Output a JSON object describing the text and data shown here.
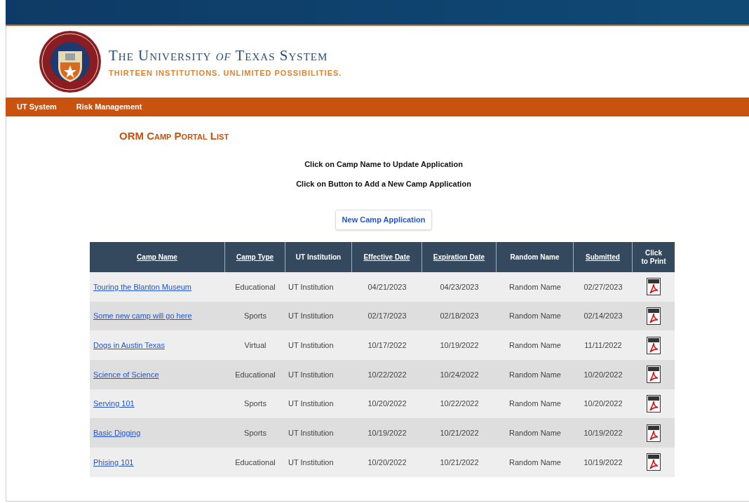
{
  "header": {
    "title": "The University *of* Texas System",
    "tagline": "THIRTEEN INSTITUTIONS. UNLIMITED POSSIBILITIES."
  },
  "nav": {
    "items": [
      "UT System",
      "Risk Management"
    ]
  },
  "page_title": "ORM Camp Portal List",
  "instructions": [
    "Click on Camp Name to Update Application",
    "Click on Button to Add a New Camp Application"
  ],
  "new_button": "New Camp Application",
  "table": {
    "columns": [
      {
        "label": "Camp Name",
        "kind": "sortable"
      },
      {
        "label": "Camp Type",
        "kind": "sortable"
      },
      {
        "label": "UT Institution",
        "kind": "plain"
      },
      {
        "label": "Effective Date",
        "kind": "sortable"
      },
      {
        "label": "Expiration Date",
        "kind": "sortable"
      },
      {
        "label": "Random Name",
        "kind": "plain"
      },
      {
        "label": "Submitted",
        "kind": "sortable"
      },
      {
        "label": "Click to Print",
        "kind": "plain"
      }
    ],
    "rows": [
      {
        "camp_name": "Touring the Blanton Museum",
        "camp_type": "Educational",
        "institution": "UT Institution",
        "effective": "04/21/2023",
        "expiration": "04/23/2023",
        "random_name": "Random Name",
        "submitted": "02/27/2023"
      },
      {
        "camp_name": "Some new camp will go here",
        "camp_type": "Sports",
        "institution": "UT Institution",
        "effective": "02/17/2023",
        "expiration": "02/18/2023",
        "random_name": "Random Name",
        "submitted": "02/14/2023"
      },
      {
        "camp_name": "Dogs in Austin Texas",
        "camp_type": "Virtual",
        "institution": "UT Institution",
        "effective": "10/17/2022",
        "expiration": "10/19/2022",
        "random_name": "Random Name",
        "submitted": "11/11/2022"
      },
      {
        "camp_name": "Science of Science",
        "camp_type": "Educational",
        "institution": "UT Institution",
        "effective": "10/22/2022",
        "expiration": "10/24/2022",
        "random_name": "Random Name",
        "submitted": "10/20/2022"
      },
      {
        "camp_name": "Serving 101",
        "camp_type": "Sports",
        "institution": "UT Institution",
        "effective": "10/20/2022",
        "expiration": "10/22/2022",
        "random_name": "Random Name",
        "submitted": "10/20/2022"
      },
      {
        "camp_name": "Basic Digging",
        "camp_type": "Sports",
        "institution": "UT Institution",
        "effective": "10/19/2022",
        "expiration": "10/21/2022",
        "random_name": "Random Name",
        "submitted": "10/19/2022"
      },
      {
        "camp_name": "Phising 101",
        "camp_type": "Educational",
        "institution": "UT Institution",
        "effective": "10/20/2022",
        "expiration": "10/21/2022",
        "random_name": "Random Name",
        "submitted": "10/19/2022"
      }
    ]
  }
}
